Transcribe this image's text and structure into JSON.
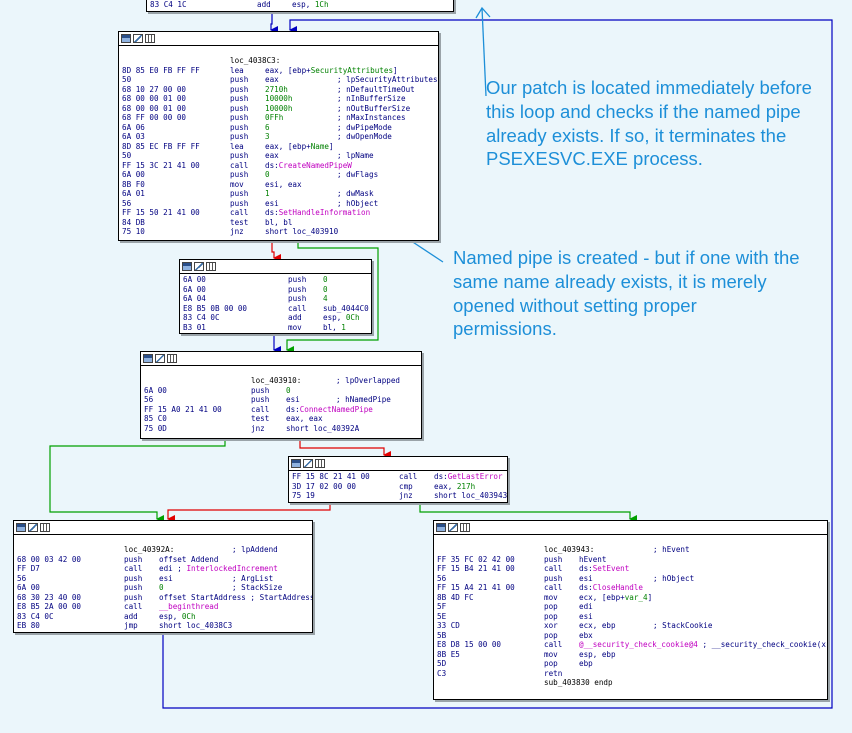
{
  "colors": {
    "flow_true": "#00a000",
    "flow_false": "#e00000",
    "flow_normal": "#0000c0",
    "callout": "#1d8fd8",
    "background": "#ebf6fb"
  },
  "toolbar_icons": [
    "graph-view-icon",
    "edit-icon",
    "listing-icon"
  ],
  "annotations": [
    {
      "name": "patch-note",
      "text": "Our patch is located immediately before this loop and checks if the named pipe already exists. If so, it terminates the PSEXESVC.EXE process."
    },
    {
      "name": "pipe-note",
      "text": "Named pipe is created - but if one with the same name already exists, it is merely opened without setting proper permissions."
    }
  ],
  "blocks": [
    {
      "id": "b0",
      "lines": [
        {
          "hex": "83 C4 1C",
          "mn": "add",
          "op": [
            {
              "t": "esp, "
            },
            {
              "t": "1Ch",
              "c": "g"
            }
          ],
          "cm": ""
        }
      ]
    },
    {
      "id": "b1",
      "lines": [
        {
          "hex": "",
          "mn": "loc_4038C3:",
          "op": [],
          "cm": ""
        },
        {
          "hex": "8D 85 E0 FB FF FF",
          "mn": "lea",
          "op": [
            {
              "t": "eax, [ebp+"
            },
            {
              "t": "SecurityAttributes",
              "c": "g"
            },
            {
              "t": "]"
            }
          ],
          "cm": ""
        },
        {
          "hex": "50",
          "mn": "push",
          "op": [
            {
              "t": "eax"
            }
          ],
          "cm": "; lpSecurityAttributes"
        },
        {
          "hex": "68 10 27 00 00",
          "mn": "push",
          "op": [
            {
              "t": "2710h",
              "c": "g"
            }
          ],
          "cm": "; nDefaultTimeOut"
        },
        {
          "hex": "68 00 00 01 00",
          "mn": "push",
          "op": [
            {
              "t": "10000h",
              "c": "g"
            }
          ],
          "cm": "; nInBufferSize"
        },
        {
          "hex": "68 00 00 01 00",
          "mn": "push",
          "op": [
            {
              "t": "10000h",
              "c": "g"
            }
          ],
          "cm": "; nOutBufferSize"
        },
        {
          "hex": "68 FF 00 00 00",
          "mn": "push",
          "op": [
            {
              "t": "0FFh",
              "c": "g"
            }
          ],
          "cm": "; nMaxInstances"
        },
        {
          "hex": "6A 06",
          "mn": "push",
          "op": [
            {
              "t": "6",
              "c": "g"
            }
          ],
          "cm": "; dwPipeMode"
        },
        {
          "hex": "6A 03",
          "mn": "push",
          "op": [
            {
              "t": "3",
              "c": "g"
            }
          ],
          "cm": "; dwOpenMode"
        },
        {
          "hex": "8D 85 EC FB FF FF",
          "mn": "lea",
          "op": [
            {
              "t": "eax, [ebp+"
            },
            {
              "t": "Name",
              "c": "g"
            },
            {
              "t": "]"
            }
          ],
          "cm": ""
        },
        {
          "hex": "50",
          "mn": "push",
          "op": [
            {
              "t": "eax"
            }
          ],
          "cm": "; lpName"
        },
        {
          "hex": "FF 15 3C 21 41 00",
          "mn": "call",
          "op": [
            {
              "t": "ds:"
            },
            {
              "t": "CreateNamedPipeW",
              "c": "m"
            }
          ],
          "cm": ""
        },
        {
          "hex": "6A 00",
          "mn": "push",
          "op": [
            {
              "t": "0",
              "c": "g"
            }
          ],
          "cm": "; dwFlags"
        },
        {
          "hex": "8B F0",
          "mn": "mov",
          "op": [
            {
              "t": "esi, eax"
            }
          ],
          "cm": ""
        },
        {
          "hex": "6A 01",
          "mn": "push",
          "op": [
            {
              "t": "1",
              "c": "g"
            }
          ],
          "cm": "; dwMask"
        },
        {
          "hex": "56",
          "mn": "push",
          "op": [
            {
              "t": "esi"
            }
          ],
          "cm": "; hObject"
        },
        {
          "hex": "FF 15 50 21 41 00",
          "mn": "call",
          "op": [
            {
              "t": "ds:"
            },
            {
              "t": "SetHandleInformation",
              "c": "m"
            }
          ],
          "cm": ""
        },
        {
          "hex": "84 DB",
          "mn": "test",
          "op": [
            {
              "t": "bl, bl"
            }
          ],
          "cm": ""
        },
        {
          "hex": "75 10",
          "mn": "jnz",
          "op": [
            {
              "t": "short loc_403910"
            }
          ],
          "cm": ""
        }
      ]
    },
    {
      "id": "b2",
      "lines": [
        {
          "hex": "6A 00",
          "mn": "push",
          "op": [
            {
              "t": "0",
              "c": "g"
            }
          ],
          "cm": ""
        },
        {
          "hex": "6A 00",
          "mn": "push",
          "op": [
            {
              "t": "0",
              "c": "g"
            }
          ],
          "cm": ""
        },
        {
          "hex": "6A 04",
          "mn": "push",
          "op": [
            {
              "t": "4",
              "c": "g"
            }
          ],
          "cm": ""
        },
        {
          "hex": "E8 B5 0B 00 00",
          "mn": "call",
          "op": [
            {
              "t": "sub_4044C0"
            }
          ],
          "cm": ""
        },
        {
          "hex": "83 C4 0C",
          "mn": "add",
          "op": [
            {
              "t": "esp, "
            },
            {
              "t": "0Ch",
              "c": "g"
            }
          ],
          "cm": ""
        },
        {
          "hex": "B3 01",
          "mn": "mov",
          "op": [
            {
              "t": "bl, "
            },
            {
              "t": "1",
              "c": "g"
            }
          ],
          "cm": ""
        }
      ]
    },
    {
      "id": "b3",
      "lines": [
        {
          "hex": "",
          "mn": "loc_403910:",
          "op": [],
          "cm": "; lpOverlapped"
        },
        {
          "hex": "6A 00",
          "mn": "push",
          "op": [
            {
              "t": "0",
              "c": "g"
            }
          ],
          "cm": ""
        },
        {
          "hex": "56",
          "mn": "push",
          "op": [
            {
              "t": "esi"
            }
          ],
          "cm": "; hNamedPipe"
        },
        {
          "hex": "FF 15 A0 21 41 00",
          "mn": "call",
          "op": [
            {
              "t": "ds:"
            },
            {
              "t": "ConnectNamedPipe",
              "c": "m"
            }
          ],
          "cm": ""
        },
        {
          "hex": "85 C0",
          "mn": "test",
          "op": [
            {
              "t": "eax, eax"
            }
          ],
          "cm": ""
        },
        {
          "hex": "75 0D",
          "mn": "jnz",
          "op": [
            {
              "t": "short loc_40392A"
            }
          ],
          "cm": ""
        }
      ]
    },
    {
      "id": "b4",
      "lines": [
        {
          "hex": "FF 15 8C 21 41 00",
          "mn": "call",
          "op": [
            {
              "t": "ds:"
            },
            {
              "t": "GetLastError",
              "c": "m"
            }
          ],
          "cm": ""
        },
        {
          "hex": "3D 17 02 00 00",
          "mn": "cmp",
          "op": [
            {
              "t": "eax, "
            },
            {
              "t": "217h",
              "c": "g"
            }
          ],
          "cm": ""
        },
        {
          "hex": "75 19",
          "mn": "jnz",
          "op": [
            {
              "t": "short loc_403943"
            }
          ],
          "cm": ""
        }
      ]
    },
    {
      "id": "b5",
      "lines": [
        {
          "hex": "",
          "mn": "loc_40392A:",
          "op": [],
          "cm": "; lpAddend"
        },
        {
          "hex": "68 00 03 42 00",
          "mn": "push",
          "op": [
            {
              "t": "offset Addend"
            }
          ],
          "cm": ""
        },
        {
          "hex": "FF D7",
          "mn": "call",
          "op": [
            {
              "t": "edi ; "
            },
            {
              "t": "InterlockedIncrement",
              "c": "m"
            }
          ],
          "cm": ""
        },
        {
          "hex": "56",
          "mn": "push",
          "op": [
            {
              "t": "esi"
            }
          ],
          "cm": "; ArgList"
        },
        {
          "hex": "6A 00",
          "mn": "push",
          "op": [
            {
              "t": "0",
              "c": "g"
            }
          ],
          "cm": "; StackSize"
        },
        {
          "hex": "68 30 23 40 00",
          "mn": "push",
          "op": [
            {
              "t": "offset StartAddress ; StartAddress"
            }
          ],
          "cm": ""
        },
        {
          "hex": "E8 B5 2A 00 00",
          "mn": "call",
          "op": [
            {
              "t": "__beginthread",
              "c": "m"
            }
          ],
          "cm": ""
        },
        {
          "hex": "83 C4 0C",
          "mn": "add",
          "op": [
            {
              "t": "esp, "
            },
            {
              "t": "0Ch",
              "c": "g"
            }
          ],
          "cm": ""
        },
        {
          "hex": "EB 80",
          "mn": "jmp",
          "op": [
            {
              "t": "short loc_4038C3"
            }
          ],
          "cm": ""
        }
      ]
    },
    {
      "id": "b6",
      "lines": [
        {
          "hex": "",
          "mn": "loc_403943:",
          "op": [],
          "cm": "; hEvent"
        },
        {
          "hex": "FF 35 FC 02 42 00",
          "mn": "push",
          "op": [
            {
              "t": "hEvent"
            }
          ],
          "cm": ""
        },
        {
          "hex": "FF 15 B4 21 41 00",
          "mn": "call",
          "op": [
            {
              "t": "ds:"
            },
            {
              "t": "SetEvent",
              "c": "m"
            }
          ],
          "cm": ""
        },
        {
          "hex": "56",
          "mn": "push",
          "op": [
            {
              "t": "esi"
            }
          ],
          "cm": "; hObject"
        },
        {
          "hex": "FF 15 A4 21 41 00",
          "mn": "call",
          "op": [
            {
              "t": "ds:"
            },
            {
              "t": "CloseHandle",
              "c": "m"
            }
          ],
          "cm": ""
        },
        {
          "hex": "8B 4D FC",
          "mn": "mov",
          "op": [
            {
              "t": "ecx, [ebp+"
            },
            {
              "t": "var_4",
              "c": "g"
            },
            {
              "t": "]"
            }
          ],
          "cm": ""
        },
        {
          "hex": "5F",
          "mn": "pop",
          "op": [
            {
              "t": "edi"
            }
          ],
          "cm": ""
        },
        {
          "hex": "5E",
          "mn": "pop",
          "op": [
            {
              "t": "esi"
            }
          ],
          "cm": ""
        },
        {
          "hex": "33 CD",
          "mn": "xor",
          "op": [
            {
              "t": "ecx, ebp"
            }
          ],
          "cm": "; StackCookie"
        },
        {
          "hex": "5B",
          "mn": "pop",
          "op": [
            {
              "t": "ebx"
            }
          ],
          "cm": ""
        },
        {
          "hex": "E8 D8 15 00 00",
          "mn": "call",
          "op": [
            {
              "t": "@__security_check_cookie@4",
              "c": "m"
            },
            {
              "t": " ; __security_check_cookie(x)"
            }
          ],
          "cm": ""
        },
        {
          "hex": "8B E5",
          "mn": "mov",
          "op": [
            {
              "t": "esp, ebp"
            }
          ],
          "cm": ""
        },
        {
          "hex": "5D",
          "mn": "pop",
          "op": [
            {
              "t": "ebp"
            }
          ],
          "cm": ""
        },
        {
          "hex": "C3",
          "mn": "retn",
          "op": [],
          "cm": ""
        },
        {
          "hex": "",
          "mn": "sub_403830 endp",
          "op": [],
          "cm": ""
        }
      ]
    }
  ]
}
